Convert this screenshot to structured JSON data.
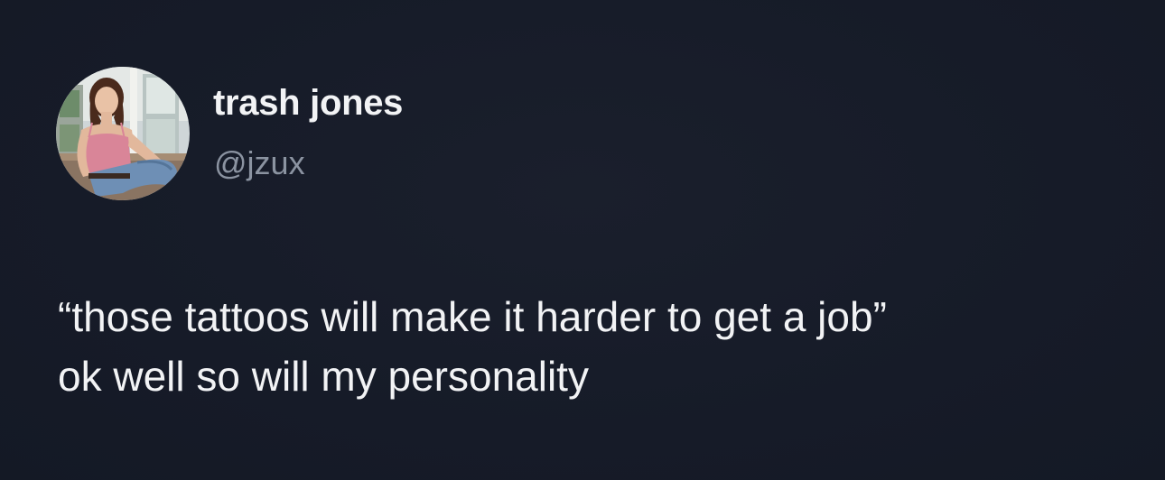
{
  "tweet": {
    "author": {
      "display_name": "trash jones",
      "handle": "@jzux",
      "avatar_icon": "profile-photo"
    },
    "text_lines": [
      "“those tattoos will make it harder to get a job”",
      "ok well so will my personality"
    ]
  },
  "colors": {
    "background": "#161b28",
    "text_primary": "#f2f3f5",
    "text_secondary": "#8b93a1"
  }
}
